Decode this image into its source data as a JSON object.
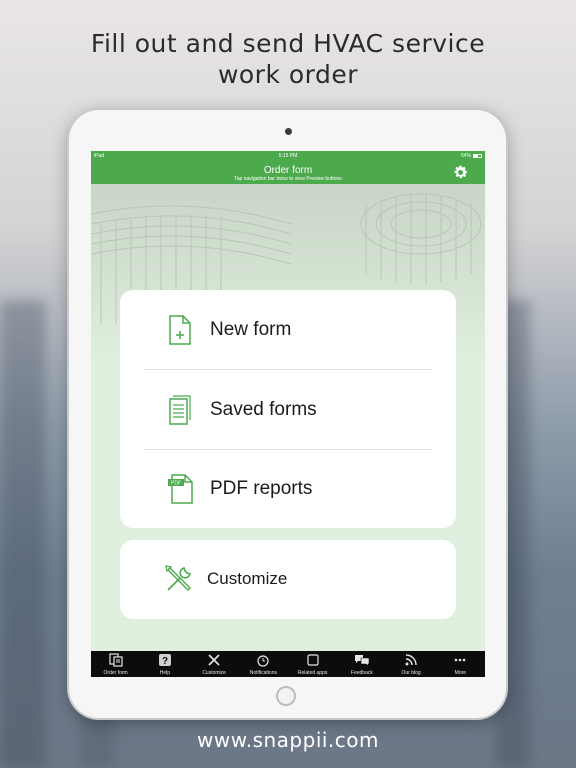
{
  "headline": {
    "line1": "Fill out and send HVAC service",
    "line2": "work order"
  },
  "footer": {
    "url": "www.snappii.com"
  },
  "status_bar": {
    "device": "iPad",
    "time": "5:15 PM",
    "battery": "64%"
  },
  "nav": {
    "title": "Order form",
    "subtitle": "Tap navigation bar twice to view Preview buttons",
    "settings_icon": "gear-icon"
  },
  "menu": {
    "items": [
      {
        "label": "New form",
        "icon": "new-document-icon"
      },
      {
        "label": "Saved forms",
        "icon": "saved-documents-icon"
      },
      {
        "label": "PDF reports",
        "icon": "pdf-document-icon"
      }
    ],
    "customize": {
      "label": "Customize",
      "icon": "tools-icon"
    }
  },
  "tabs": [
    {
      "label": "Order form",
      "icon": "order-form-icon"
    },
    {
      "label": "Help",
      "icon": "help-icon"
    },
    {
      "label": "Customize",
      "icon": "tools-icon"
    },
    {
      "label": "Notifications",
      "icon": "notifications-icon"
    },
    {
      "label": "Related apps",
      "icon": "related-apps-icon"
    },
    {
      "label": "Feedback",
      "icon": "feedback-icon"
    },
    {
      "label": "Our blog",
      "icon": "rss-icon"
    },
    {
      "label": "More",
      "icon": "more-icon"
    }
  ],
  "colors": {
    "accent_green": "#4caa4d",
    "icon_green": "#4caa4d",
    "screen_bg": "#dff0de",
    "tabbar_bg": "#0c0c0c"
  }
}
